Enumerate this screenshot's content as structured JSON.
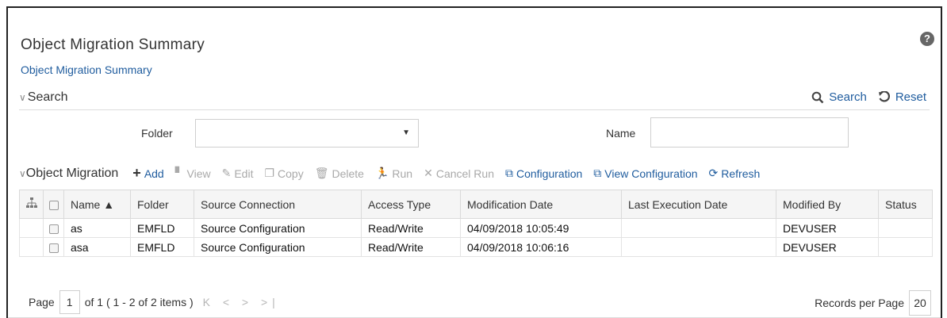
{
  "page": {
    "title": "Object Migration Summary",
    "breadcrumb": "Object Migration Summary",
    "help_icon": "?"
  },
  "search": {
    "section_label": "Search",
    "chevron": "∨",
    "search_label": "Search",
    "reset_label": "Reset",
    "folder_label": "Folder",
    "folder_value": "",
    "name_label": "Name",
    "name_value": ""
  },
  "toolbar": {
    "section_label": "Object Migration",
    "add": "Add",
    "view": "View",
    "edit": "Edit",
    "copy": "Copy",
    "delete": "Delete",
    "run": "Run",
    "cancel_run": "Cancel Run",
    "configuration": "Configuration",
    "view_configuration": "View Configuration",
    "refresh": "Refresh"
  },
  "table": {
    "columns": {
      "name": "Name ▲",
      "folder": "Folder",
      "source_connection": "Source Connection",
      "access_type": "Access Type",
      "modification_date": "Modification Date",
      "last_execution_date": "Last Execution Date",
      "modified_by": "Modified By",
      "status": "Status"
    },
    "rows": [
      {
        "name": "as",
        "folder": "EMFLD",
        "source_connection": "Source Configuration",
        "access_type": "Read/Write",
        "modification_date": "04/09/2018 10:05:49",
        "last_execution_date": "",
        "modified_by": "DEVUSER",
        "status": ""
      },
      {
        "name": "asa",
        "folder": "EMFLD",
        "source_connection": "Source Configuration",
        "access_type": "Read/Write",
        "modification_date": "04/09/2018 10:06:16",
        "last_execution_date": "",
        "modified_by": "DEVUSER",
        "status": ""
      }
    ]
  },
  "pager": {
    "page_label": "Page",
    "page_value": "1",
    "summary": "of 1 ( 1 - 2 of 2 items )",
    "nav": "K < > >|",
    "records_label": "Records per Page",
    "records_value": "20"
  },
  "colors": {
    "link": "#1f5c9e",
    "disabled": "#a9a9a9",
    "header_bg": "#f5f5f5"
  }
}
